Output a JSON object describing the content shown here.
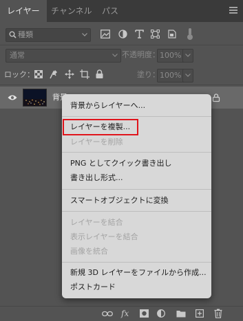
{
  "tabs": [
    {
      "label": "レイヤー",
      "active": true
    },
    {
      "label": "チャンネル",
      "active": false
    },
    {
      "label": "パス",
      "active": false
    }
  ],
  "filter": {
    "kind_value": "種類",
    "icons": [
      "pixel-filter-icon",
      "adjustment-filter-icon",
      "type-filter-icon",
      "shape-filter-icon",
      "smart-object-filter-icon",
      "filter-toggle-icon"
    ]
  },
  "blend": {
    "mode_value": "通常",
    "opacity_label": "不透明度：",
    "opacity_value": "100%"
  },
  "lock": {
    "label": "ロック：",
    "fill_label": "塗り：",
    "fill_value": "100%"
  },
  "layer": {
    "name": "背景",
    "visible": true,
    "locked": true
  },
  "context_menu": {
    "items": [
      {
        "label": "背景からレイヤーへ...",
        "enabled": true
      },
      {
        "label": "レイヤーを複製...",
        "enabled": true,
        "highlighted": true
      },
      {
        "label": "レイヤーを削除",
        "enabled": false
      },
      {
        "label": "PNG としてクイック書き出し",
        "enabled": true
      },
      {
        "label": "書き出し形式...",
        "enabled": true
      },
      {
        "label": "スマートオブジェクトに変換",
        "enabled": true
      },
      {
        "label": "レイヤーを結合",
        "enabled": false
      },
      {
        "label": "表示レイヤーを結合",
        "enabled": false
      },
      {
        "label": "画像を統合",
        "enabled": false
      },
      {
        "label": "新規 3D レイヤーをファイルから作成...",
        "enabled": true
      },
      {
        "label": "ポストカード",
        "enabled": true
      }
    ],
    "highlight_color": "#e0141b"
  },
  "bottom_bar": {
    "fx_label": "fx",
    "icons": [
      "link-layers-icon",
      "add-layer-style-icon",
      "add-mask-icon",
      "new-adjustment-layer-icon",
      "new-group-icon",
      "new-layer-icon",
      "delete-layer-icon"
    ]
  },
  "colors": {
    "panel_bg": "#535353",
    "tabbar_bg": "#3a3a3a",
    "selected_row": "#696969",
    "menu_bg": "#d8d8d8"
  }
}
